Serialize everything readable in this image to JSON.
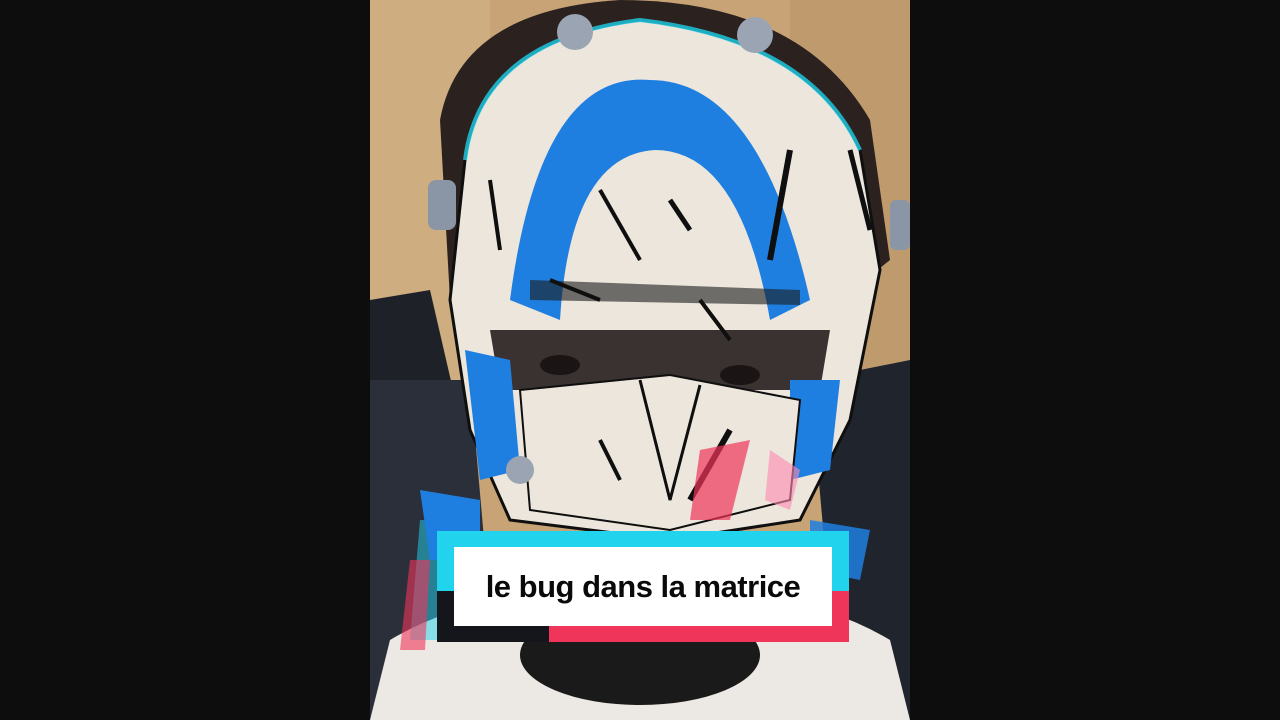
{
  "caption": {
    "text": "le bug dans la matrice"
  },
  "colors": {
    "background": "#0d0d0d",
    "caption_cyan": "#22d3ee",
    "caption_red": "#f0355a",
    "caption_box": "#ffffff",
    "mask_white": "#ece6dc",
    "mask_blue": "#1f7fe0",
    "wall_tan": "#c9a57a"
  },
  "scene": {
    "subject": "person-wearing-painted-3d-printed-mask-icon"
  }
}
